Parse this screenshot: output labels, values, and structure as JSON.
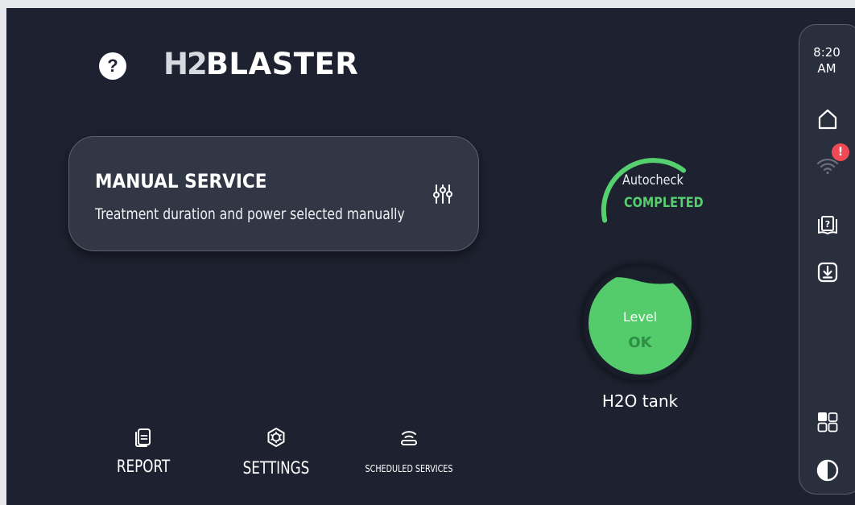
{
  "header": {
    "help_icon_glyph": "?",
    "logo_prefix": "H2",
    "logo_suffix": "BLASTER"
  },
  "service_card": {
    "title": "MANUAL SERVICE",
    "description": "Treatment duration and power selected manually",
    "icon": "sliders-icon"
  },
  "autocheck": {
    "label": "Autocheck",
    "status": "COMPLETED",
    "status_color": "#56cf6e"
  },
  "tank": {
    "level_label": "Level",
    "level_value": "OK",
    "name": "H2O tank",
    "fill_color": "#54cc6c"
  },
  "bottom_nav": [
    {
      "label": "REPORT",
      "icon": "report-icon"
    },
    {
      "label": "SETTINGS",
      "icon": "settings-icon"
    },
    {
      "label": "SCHEDULED SERVICES",
      "icon": "scheduled-icon"
    }
  ],
  "side_rail": {
    "time": "8:20",
    "meridiem": "AM",
    "icons": [
      "home-icon",
      "wifi-icon",
      "manual-icon",
      "download-icon",
      "apps-icon",
      "contrast-icon"
    ],
    "wifi_alert_glyph": "!",
    "alert_color": "#f04a55"
  },
  "colors": {
    "background": "#1e2230",
    "card": "#323746",
    "accent_green": "#56cf6e"
  }
}
